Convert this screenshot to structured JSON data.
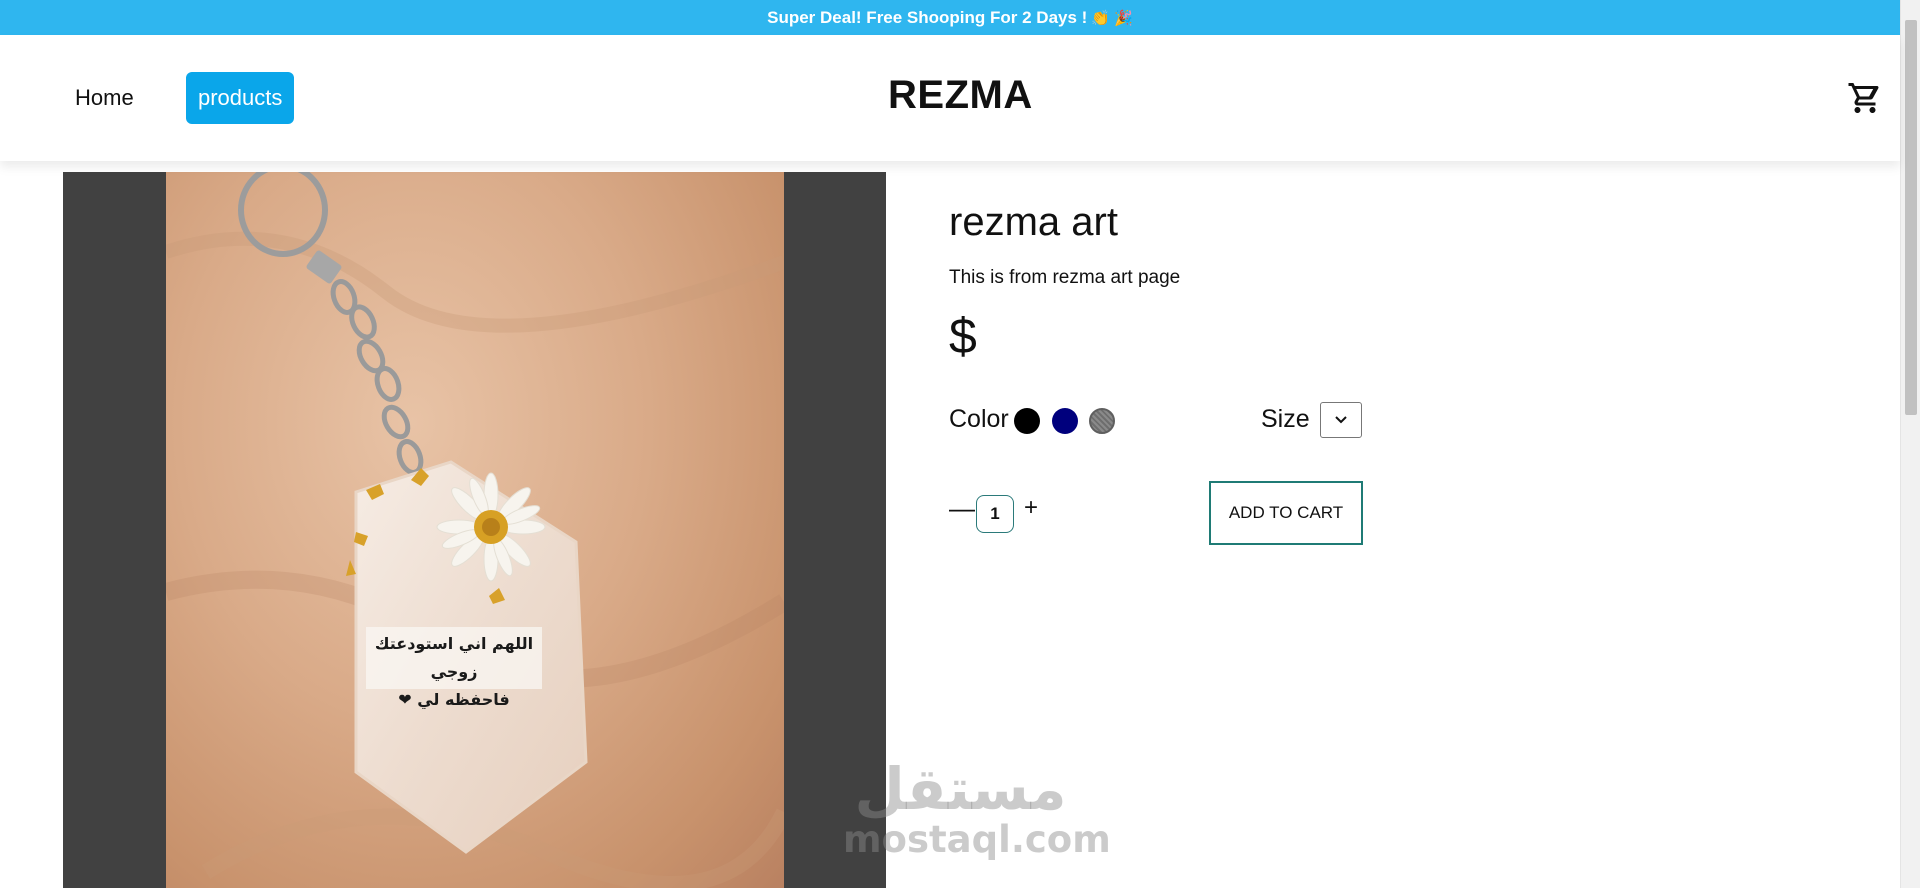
{
  "announcement": {
    "text": "Super Deal! Free Shooping For 2 Days !",
    "emojis": "👏 🎉"
  },
  "nav": {
    "home_label": "Home",
    "products_label": "products",
    "brand": "REZMA",
    "cart_icon": "cart-icon",
    "active_link": "products",
    "active_color": "#0aa6ea"
  },
  "product": {
    "title": "rezma art",
    "description": "This is from rezma art page",
    "price": "$",
    "image_caption_line1": "اللهم اني استودعتك زوجي",
    "image_caption_line2": "فاحفظه لي ❤",
    "color_label": "Color",
    "colors": [
      "#000000",
      "#00007d",
      "#808080"
    ],
    "size_label": "Size",
    "size_selected": "",
    "quantity": "1",
    "minus_label": "—",
    "plus_label": "+",
    "add_to_cart_label": "ADD TO CART"
  },
  "watermark": {
    "arabic": "مستقل",
    "latin": "mostaql.com"
  },
  "colors": {
    "announcement_bg": "#2fb6ef",
    "gallery_bg": "#414141",
    "button_border": "#1f7b75"
  }
}
